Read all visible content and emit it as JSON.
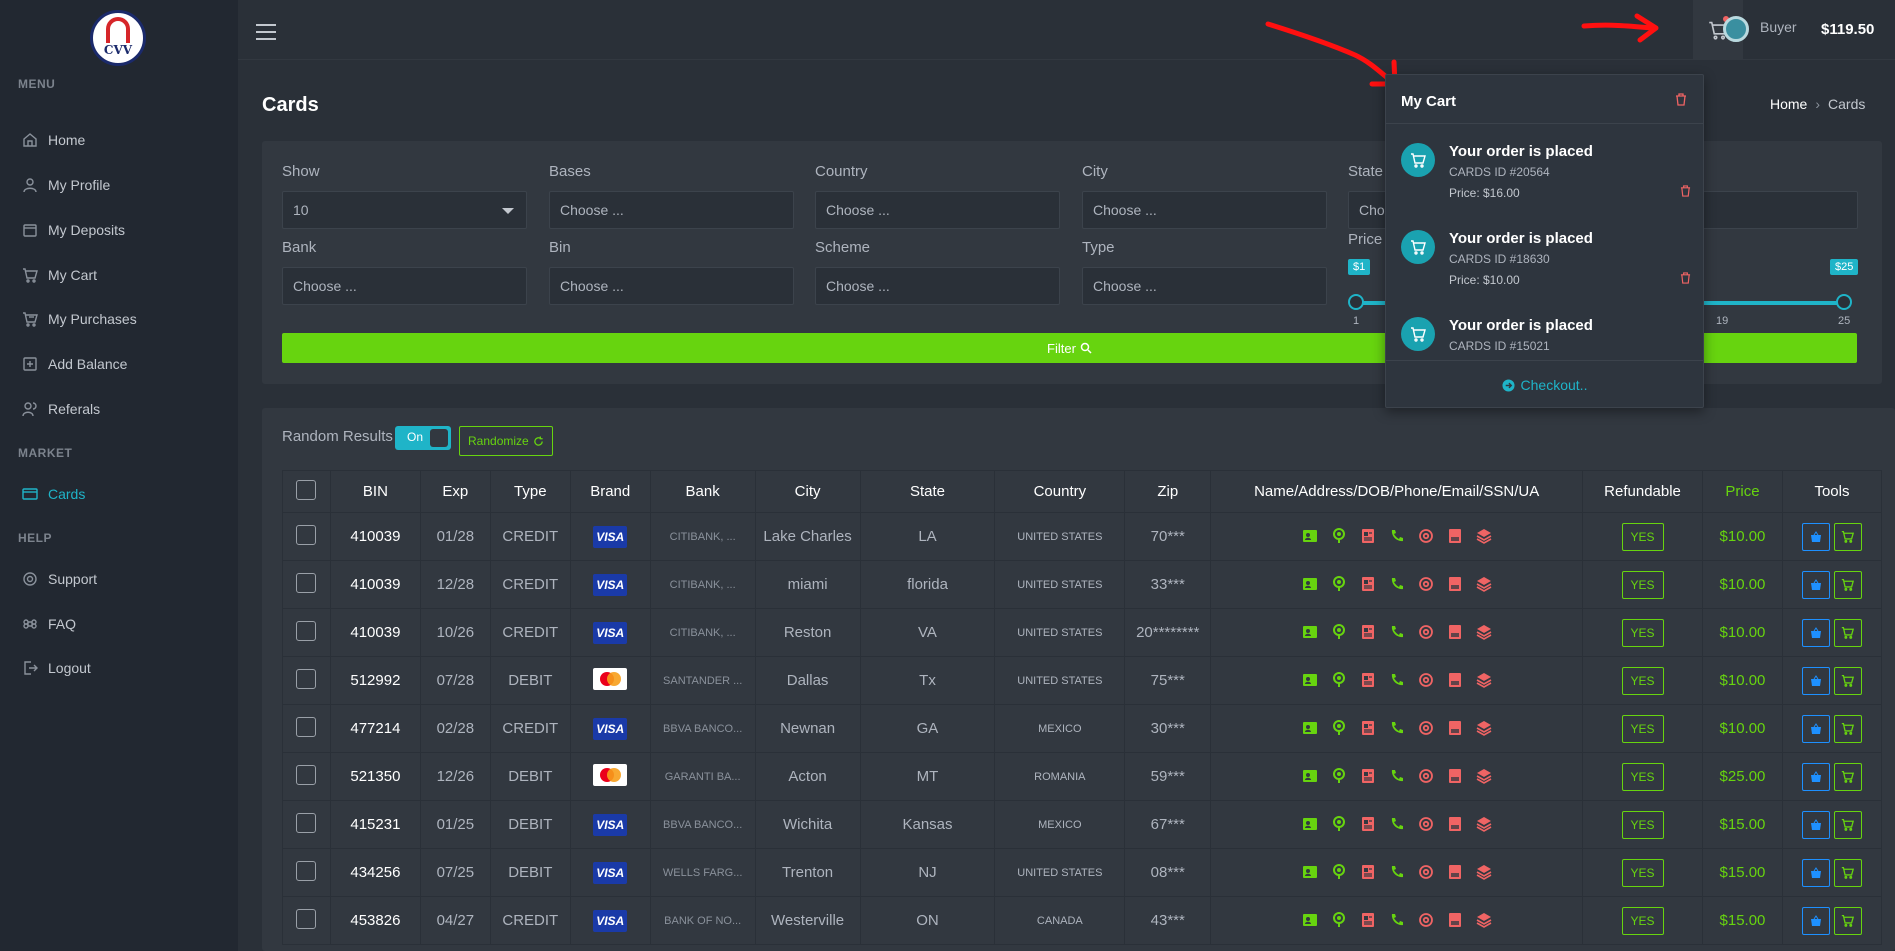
{
  "brand": {
    "logo_text": "CVV"
  },
  "sidebar": {
    "sections": [
      "MENU",
      "MARKET",
      "HELP"
    ],
    "items": [
      {
        "label": "Home",
        "icon": "home-icon"
      },
      {
        "label": "My Profile",
        "icon": "user-icon"
      },
      {
        "label": "My Deposits",
        "icon": "wallet-icon"
      },
      {
        "label": "My Cart",
        "icon": "cart-icon"
      },
      {
        "label": "My Purchases",
        "icon": "bag-icon"
      },
      {
        "label": "Add Balance",
        "icon": "plus-square-icon"
      },
      {
        "label": "Referals",
        "icon": "users-icon"
      },
      {
        "label": "Cards",
        "icon": "card-icon"
      },
      {
        "label": "Support",
        "icon": "support-icon"
      },
      {
        "label": "FAQ",
        "icon": "command-icon"
      },
      {
        "label": "Logout",
        "icon": "logout-icon"
      }
    ]
  },
  "header": {
    "username": "Buyer",
    "balance": "$119.50"
  },
  "page": {
    "title": "Cards",
    "breadcrumb_home": "Home",
    "breadcrumb_sep": "›",
    "breadcrumb_current": "Cards"
  },
  "filters": {
    "show_label": "Show",
    "show_value": "10",
    "bases_label": "Bases",
    "country_label": "Country",
    "city_label": "City",
    "state_label": "State",
    "bank_label": "Bank",
    "bin_label": "Bin",
    "scheme_label": "Scheme",
    "type_label": "Type",
    "price_label": "Price",
    "placeholder": "Choose ...",
    "state_placeholder_partial": "Cho",
    "filter_button": "Filter",
    "price_min_badge": "$1",
    "price_max_badge": "$25",
    "tick_min": "1",
    "tick_19": "19",
    "tick_max": "25",
    "price_min": 1,
    "price_max": 25
  },
  "table_controls": {
    "random_label": "Random Results",
    "toggle_label": "On",
    "randomize_label": "Randomize"
  },
  "table": {
    "headers": [
      "BIN",
      "Exp",
      "Type",
      "Brand",
      "Bank",
      "City",
      "State",
      "Country",
      "Zip",
      "Name/Address/DOB/Phone/Email/SSN/UA",
      "Refundable",
      "Price",
      "Tools"
    ],
    "rows": [
      {
        "bin": "410039",
        "exp": "01/28",
        "type": "CREDIT",
        "brand": "visa",
        "bank": "CITIBANK, ...",
        "city": "Lake Charles",
        "state": "LA",
        "country": "UNITED STATES",
        "zip": "70***",
        "refundable": "YES",
        "price": "$10.00"
      },
      {
        "bin": "410039",
        "exp": "12/28",
        "type": "CREDIT",
        "brand": "visa",
        "bank": "CITIBANK, ...",
        "city": "miami",
        "state": "florida",
        "country": "UNITED STATES",
        "zip": "33***",
        "refundable": "YES",
        "price": "$10.00"
      },
      {
        "bin": "410039",
        "exp": "10/26",
        "type": "CREDIT",
        "brand": "visa",
        "bank": "CITIBANK, ...",
        "city": "Reston",
        "state": "VA",
        "country": "UNITED STATES",
        "zip": "20********",
        "refundable": "YES",
        "price": "$10.00"
      },
      {
        "bin": "512992",
        "exp": "07/28",
        "type": "DEBIT",
        "brand": "mastercard",
        "bank": "SANTANDER ...",
        "city": "Dallas",
        "state": "Tx",
        "country": "UNITED STATES",
        "zip": "75***",
        "refundable": "YES",
        "price": "$10.00"
      },
      {
        "bin": "477214",
        "exp": "02/28",
        "type": "CREDIT",
        "brand": "visa",
        "bank": "BBVA BANCO...",
        "city": "Newnan",
        "state": "GA",
        "country": "MEXICO",
        "zip": "30***",
        "refundable": "YES",
        "price": "$10.00"
      },
      {
        "bin": "521350",
        "exp": "12/26",
        "type": "DEBIT",
        "brand": "mastercard",
        "bank": "GARANTI BA...",
        "city": "Acton",
        "state": "MT",
        "country": "ROMANIA",
        "zip": "59***",
        "refundable": "YES",
        "price": "$25.00"
      },
      {
        "bin": "415231",
        "exp": "01/25",
        "type": "DEBIT",
        "brand": "visa",
        "bank": "BBVA BANCO...",
        "city": "Wichita",
        "state": "Kansas",
        "country": "MEXICO",
        "zip": "67***",
        "refundable": "YES",
        "price": "$15.00"
      },
      {
        "bin": "434256",
        "exp": "07/25",
        "type": "DEBIT",
        "brand": "visa",
        "bank": "WELLS FARG...",
        "city": "Trenton",
        "state": "NJ",
        "country": "UNITED STATES",
        "zip": "08***",
        "refundable": "YES",
        "price": "$15.00"
      },
      {
        "bin": "453826",
        "exp": "04/27",
        "type": "CREDIT",
        "brand": "visa",
        "bank": "BANK OF NO...",
        "city": "Westerville",
        "state": "ON",
        "country": "CANADA",
        "zip": "43***",
        "refundable": "YES",
        "price": "$15.00"
      }
    ]
  },
  "cart": {
    "title": "My Cart",
    "items": [
      {
        "heading": "Your order is placed",
        "sub": "CARDS ID #20564",
        "price": "Price: $16.00"
      },
      {
        "heading": "Your order is placed",
        "sub": "CARDS ID #18630",
        "price": "Price: $10.00"
      },
      {
        "heading": "Your order is placed",
        "sub": "CARDS ID #15021",
        "price": ""
      }
    ],
    "checkout": "Checkout.."
  },
  "colors": {
    "accent": "#1fb4c8",
    "green": "#67d40f",
    "red": "#f06464",
    "sidebar": "#222831",
    "bg": "#2a3038"
  }
}
